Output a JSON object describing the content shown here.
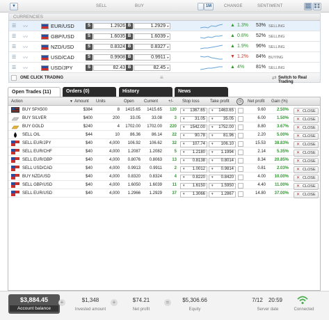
{
  "header": {
    "filter_icon_label": "▼",
    "sell": "SELL",
    "buy": "BUY",
    "timeframe": "1M",
    "change": "CHANGE",
    "sentiment": "SENTIMENT"
  },
  "currencies": {
    "title": "CURRENCIES",
    "rows": [
      {
        "pair": "EUR/USD",
        "sell": "1.2926",
        "buy": "1.2929",
        "change": "1.3%",
        "dir": "up",
        "sentiment": "53%",
        "sentiment_label": "SELLING",
        "selected": true
      },
      {
        "pair": "GBP/USD",
        "sell": "1.6035",
        "buy": "1.6039",
        "change": "0.8%",
        "dir": "up",
        "sentiment": "52%",
        "sentiment_label": "SELLING",
        "selected": false
      },
      {
        "pair": "NZD/USD",
        "sell": "0.8324",
        "buy": "0.8327",
        "change": "1.9%",
        "dir": "up",
        "sentiment": "96%",
        "sentiment_label": "SELLING",
        "selected": false
      },
      {
        "pair": "USD/CAD",
        "sell": "0.9908",
        "buy": "0.9911",
        "change": "1.2%",
        "dir": "down",
        "sentiment": "84%",
        "sentiment_label": "BUYING",
        "selected": false
      },
      {
        "pair": "USD/JPY",
        "sell": "82.43",
        "buy": "82.45",
        "change": "4%",
        "dir": "up",
        "sentiment": "81%",
        "sentiment_label": "SELLING",
        "selected": false
      }
    ]
  },
  "one_click": {
    "label": "ONE CLICK TRADING",
    "switch_label": "Switch to Real Trading"
  },
  "tabs": {
    "open_trades": "Open Trades (11)",
    "orders": "Orders (0)",
    "history": "History",
    "news": "News"
  },
  "table": {
    "headers": {
      "action": "Action",
      "amount": "Amount",
      "units": "Units",
      "open": "Open",
      "current": "Current",
      "pips": "+/-",
      "stop_loss": "Stop loss",
      "take_profit": "Take profit",
      "net_profit": "Net profit",
      "gain": "Gain (%)"
    },
    "close_label": "CLOSE",
    "rows": [
      {
        "action": "BUY SPX500",
        "amount": "$384",
        "units": "8",
        "open": "1415.65",
        "current": "1415.65",
        "pips": "120",
        "stop": "1367.65",
        "take": "1463.65",
        "net": "9.60",
        "gain": "2.50%",
        "icon": "spx"
      },
      {
        "action": "BUY SILVER",
        "amount": "$400",
        "units": "200",
        "open": "33.05",
        "current": "33.08",
        "pips": "3",
        "stop": "31.05",
        "take": "35.05",
        "net": "6.00",
        "gain": "1.50%",
        "icon": "silver"
      },
      {
        "action": "BUY GOLD",
        "amount": "$240",
        "units": "4",
        "open": "1702.00",
        "current": "1702.00",
        "pips": "220",
        "stop": "1542.00",
        "take": "1752.00",
        "net": "8.80",
        "gain": "3.67%",
        "icon": "gold"
      },
      {
        "action": "SELL OIL",
        "amount": "$44",
        "units": "10",
        "open": "86.36",
        "current": "86.14",
        "pips": "22",
        "stop": "90.78",
        "take": "81.96",
        "net": "2.20",
        "gain": "5.00%",
        "icon": "oil"
      },
      {
        "action": "SELL EUR/JPY",
        "amount": "$40",
        "units": "4,000",
        "open": "106.92",
        "current": "106.62",
        "pips": "32",
        "stop": "107.74",
        "take": "106.10",
        "net": "15.53",
        "gain": "38.83%",
        "icon": "flag"
      },
      {
        "action": "SELL EUR/CHF",
        "amount": "$40",
        "units": "4,000",
        "open": "1.2087",
        "current": "1.2082",
        "pips": "5",
        "stop": "1.2180",
        "take": "1.1994",
        "net": "2.14",
        "gain": "5.35%",
        "icon": "flag"
      },
      {
        "action": "SELL EUR/GBP",
        "amount": "$40",
        "units": "4,000",
        "open": "0.8076",
        "current": "0.8063",
        "pips": "13",
        "stop": "0.8138",
        "take": "0.8014",
        "net": "8.34",
        "gain": "20.85%",
        "icon": "flag"
      },
      {
        "action": "SELL USD/CAD",
        "amount": "$40",
        "units": "4,000",
        "open": "0.9913",
        "current": "0.9911",
        "pips": "2",
        "stop": "1.0012",
        "take": "0.9814",
        "net": "0.81",
        "gain": "2.03%",
        "icon": "flag"
      },
      {
        "action": "BUY NZD/USD",
        "amount": "$40",
        "units": "4,000",
        "open": "0.8320",
        "current": "0.8324",
        "pips": "4",
        "stop": "0.8220",
        "take": "0.8420",
        "net": "4.00",
        "gain": "10.00%",
        "icon": "flag"
      },
      {
        "action": "SELL GBP/USD",
        "amount": "$40",
        "units": "4,000",
        "open": "1.6050",
        "current": "1.6039",
        "pips": "11",
        "stop": "1.6150",
        "take": "1.5950",
        "net": "4.40",
        "gain": "11.00%",
        "icon": "flag"
      },
      {
        "action": "SELL EUR/USD",
        "amount": "$40",
        "units": "4,000",
        "open": "1.2966",
        "current": "1.2929",
        "pips": "37",
        "stop": "1.3066",
        "take": "1.2867",
        "net": "14.80",
        "gain": "37.00%",
        "icon": "flag"
      }
    ]
  },
  "footer": {
    "balance_value": "$3,884.45",
    "balance_label": "Account balance",
    "invested_value": "$1,348",
    "invested_label": "Invested amount",
    "net_value": "$74.21",
    "net_label": "Net profit",
    "equity_value": "$5,306.66",
    "equity_label": "Equity",
    "date_value": "7/12",
    "time_value": "20:59",
    "server_label": "Server date",
    "connected_label": "Connected",
    "plus": "+",
    "eq": "="
  },
  "colors": {
    "up": "#2e9a2e",
    "down": "#d03a2e",
    "accent": "#1f5f9a",
    "dark_tab": "#2b2b2b",
    "connected": "#4caf50"
  }
}
